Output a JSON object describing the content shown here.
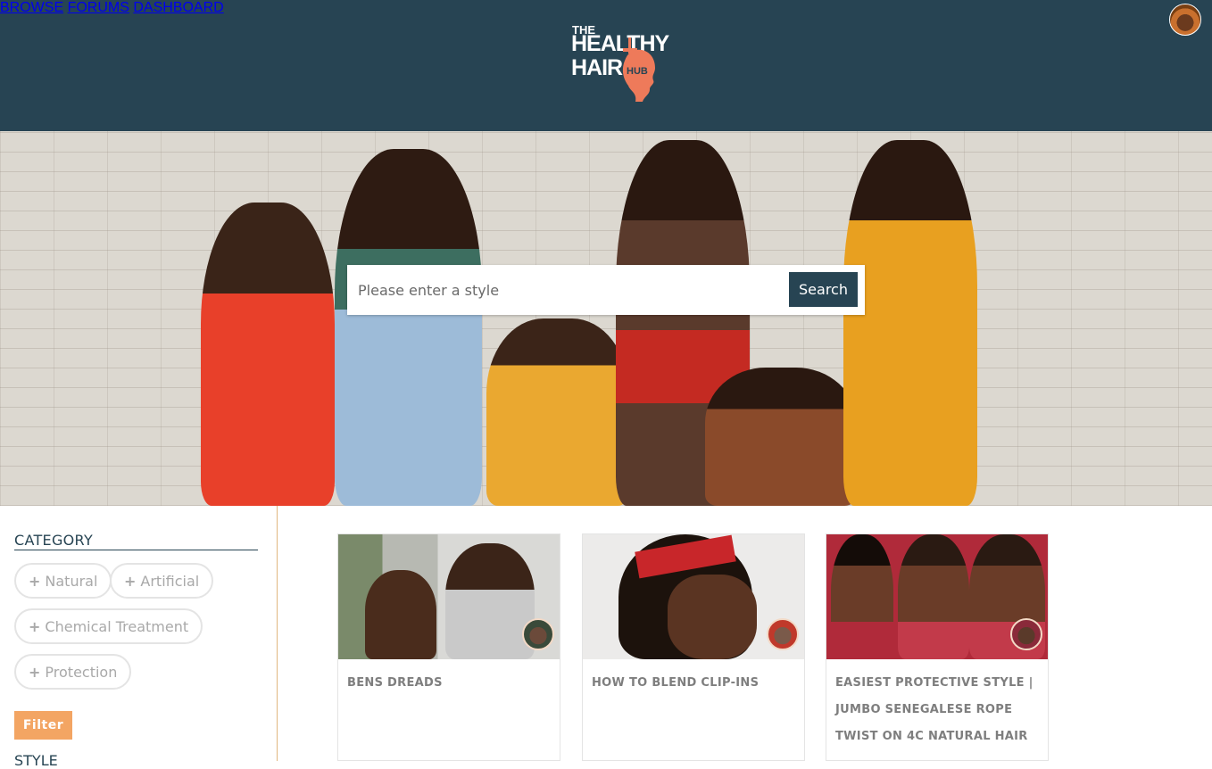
{
  "brand": {
    "line1": "THE",
    "line2": "HEALTHY",
    "line3": "HAIR",
    "badge": "HUB",
    "logo_icon": "comb-head-logo"
  },
  "nav": {
    "items": [
      "BROWSE",
      "FORUMS",
      "DASHBOARD"
    ],
    "avatar_icon": "user-avatar"
  },
  "hero": {
    "search_placeholder": "Please enter a style",
    "search_button": "Search"
  },
  "sidebar": {
    "category_title": "CATEGORY",
    "chips": [
      "Natural",
      "Artificial",
      "Chemical Treatment",
      "Protection"
    ],
    "filter_button": "Filter",
    "style_title": "STYLE"
  },
  "cards": [
    {
      "title": "BENS DREADS"
    },
    {
      "title": "HOW TO BLEND CLIP-INS"
    },
    {
      "title": "EASIEST PROTECTIVE STYLE | JUMBO SENEGALESE ROPE TWIST ON 4C NATURAL HAIR"
    }
  ],
  "colors": {
    "header": "#274453",
    "accent": "#ee7a5a",
    "filter": "#f3a563",
    "divider": "#e0b77f"
  }
}
